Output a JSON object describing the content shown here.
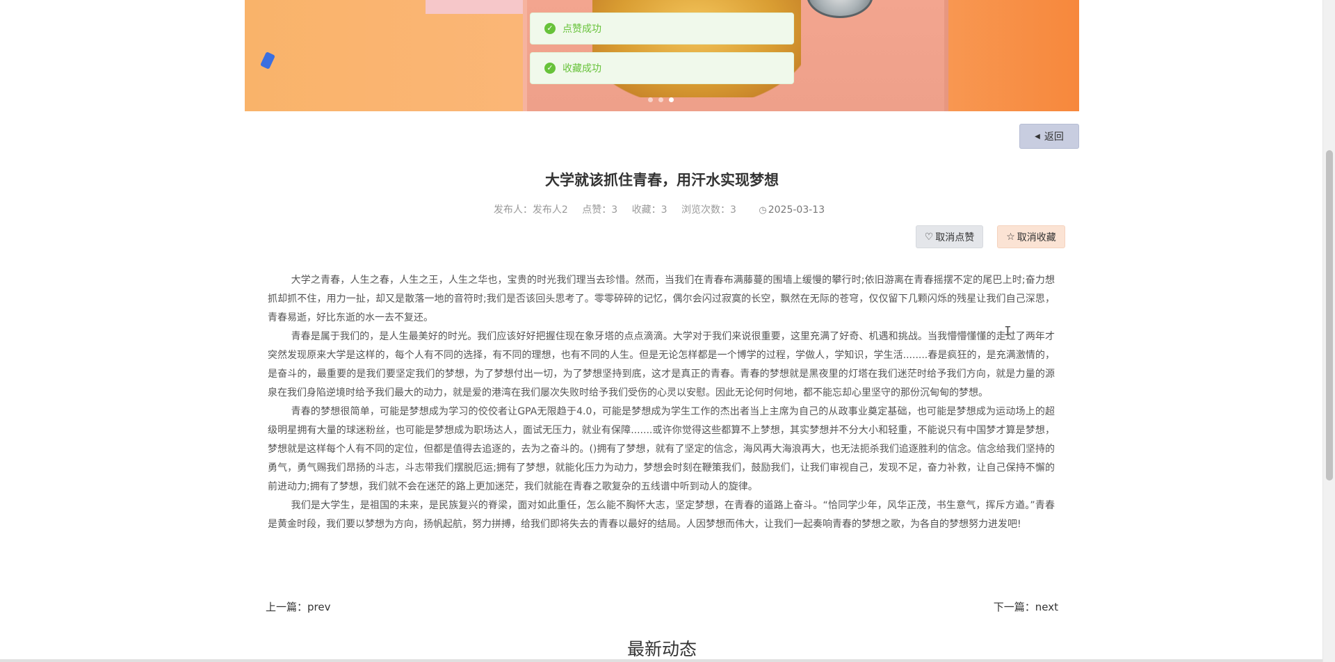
{
  "toasts": {
    "like_success": "点赞成功",
    "collect_success": "收藏成功"
  },
  "back_button": {
    "label": "返回"
  },
  "article": {
    "title": "大学就该抓住青春，用汗水实现梦想",
    "meta": {
      "publisher_label": "发布人：",
      "publisher": "发布人2",
      "likes_label": "点赞：",
      "likes": "3",
      "collects_label": "收藏：",
      "collects": "3",
      "views_label": "浏览次数：",
      "views": "3",
      "date": "2025-03-13"
    },
    "actions": {
      "unlike": "取消点赞",
      "uncollect": "取消收藏"
    },
    "paragraphs": [
      "大学之青春，人生之春，人生之王，人生之华也，宝贵的时光我们理当去珍惜。然而，当我们在青春布满藤蔓的围墙上缓慢的攀行时;依旧游离在青春摇摆不定的尾巴上时;奋力想抓却抓不住，用力一扯，却又是散落一地的音符时;我们是否该回头思考了。零零碎碎的记忆，偶尔会闪过寂寞的长空，飘然在无际的苍穹，仅仅留下几颗闪烁的残星让我们自己深思，青春易逝，好比东逝的水一去不复还。",
      "青春是属于我们的，是人生最美好的时光。我们应该好好把握住现在象牙塔的点点滴滴。大学对于我们来说很重要，这里充满了好奇、机遇和挑战。当我懵懵懂懂的走过了两年才突然发现原来大学是这样的，每个人有不同的选择，有不同的理想，也有不同的人生。但是无论怎样都是一个博学的过程，学做人，学知识，学生活........春是疯狂的，是充满激情的，是奋斗的，最重要的是我们要坚定我们的梦想，为了梦想付出一切，为了梦想坚持到底，这才是真正的青春。青春的梦想就是黑夜里的灯塔在我们迷茫时给予我们方向，就是力量的源泉在我们身陷逆境时给予我们最大的动力，就是爱的港湾在我们屡次失败时给予我们受伤的心灵以安慰。因此无论何时何地，都不能忘却心里坚守的那份沉甸甸的梦想。",
      "青春的梦想很简单，可能是梦想成为学习的佼佼者让GPA无限趋于4.0，可能是梦想成为学生工作的杰出者当上主席为自己的从政事业奠定基础，也可能是梦想成为运动场上的超级明星拥有大量的球迷粉丝，也可能是梦想成为职场达人，面试无压力，就业有保障.......或许你觉得这些都算不上梦想，其实梦想并不分大小和轻重，不能说只有中国梦才算是梦想，梦想就是这样每个人有不同的定位，但都是值得去追逐的，去为之奋斗的。()拥有了梦想，就有了坚定的信念，海风再大海浪再大，也无法扼杀我们追逐胜利的信念。信念给我们坚持的勇气，勇气赐我们昂扬的斗志，斗志带我们摆脱厄运;拥有了梦想，就能化压力为动力，梦想会时刻在鞭策我们，鼓励我们，让我们审视自己，发现不足，奋力补救，让自己保持不懈的前进动力;拥有了梦想，我们就不会在迷茫的路上更加迷茫，我们就能在青春之歌复杂的五线谱中听到动人的旋律。",
      "我们是大学生，是祖国的未来，是民族复兴的脊梁，面对如此重任，怎么能不胸怀大志，坚定梦想，在青春的道路上奋斗。“恰同学少年，风华正茂，书生意气，挥斥方遒。”青春是黄金时段，我们要以梦想为方向，扬帆起航，努力拼搏，给我们即将失去的青春以最好的结局。人因梦想而伟大，让我们一起奏响青春的梦想之歌，为各自的梦想努力进发吧!"
    ]
  },
  "navigation": {
    "prev_label": "上一篇：",
    "prev": "prev",
    "next_label": "下一篇：",
    "next": "next"
  },
  "latest_section": {
    "title": "最新动态"
  },
  "icons": {
    "toast": "check-circle-icon",
    "back": "caret-left-icon",
    "unlike": "heart-icon",
    "uncollect": "star-icon",
    "date": "clock-icon"
  },
  "colors": {
    "toast_text": "#67c23a",
    "toast_bg": "#f0f9eb",
    "back_button_bg": "#c8cde0",
    "unlike_button_bg": "#e4e6ea",
    "uncollect_button_bg": "#fbe3d4"
  }
}
